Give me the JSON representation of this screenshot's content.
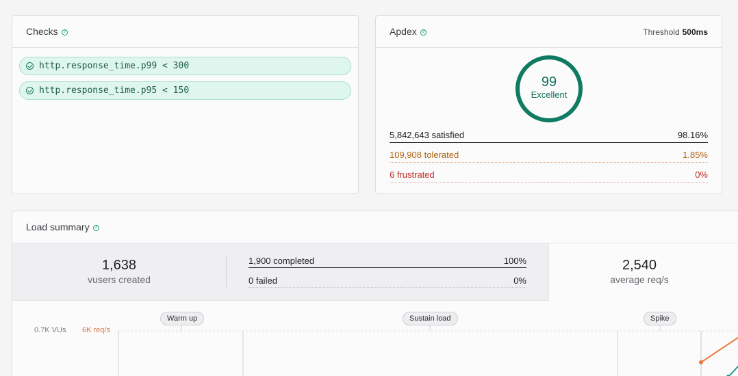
{
  "checks": {
    "title": "Checks",
    "items": [
      {
        "label": "http.response_time.p99 < 300"
      },
      {
        "label": "http.response_time.p95 < 150"
      }
    ]
  },
  "apdex": {
    "title": "Apdex",
    "threshold_label": "Threshold",
    "threshold_value": "500ms",
    "score": "99",
    "rating": "Excellent",
    "rows": [
      {
        "label": "5,842,643 satisfied",
        "pct": "98.16%"
      },
      {
        "label": "109,908 tolerated",
        "pct": "1.85%"
      },
      {
        "label": "6 frustrated",
        "pct": "0%"
      }
    ],
    "colors": {
      "ring": "#0f7b62",
      "tolerated": "#b06410",
      "frustrated": "#bd2f24"
    }
  },
  "load": {
    "title": "Load summary",
    "vusers_value": "1,638",
    "vusers_label": "vusers created",
    "completed_label": "1,900 completed",
    "completed_pct": "100%",
    "failed_label": "0 failed",
    "failed_pct": "0%",
    "avg_value": "2,540",
    "avg_label": "average req/s",
    "phases": [
      "Warm up",
      "Sustain load",
      "Spike"
    ],
    "axis_left_top": "0.7K VUs",
    "axis_right_top": "6K req/s",
    "colors": {
      "vus_line": "#1d9a8a",
      "req_line": "#ea7a3a"
    }
  }
}
